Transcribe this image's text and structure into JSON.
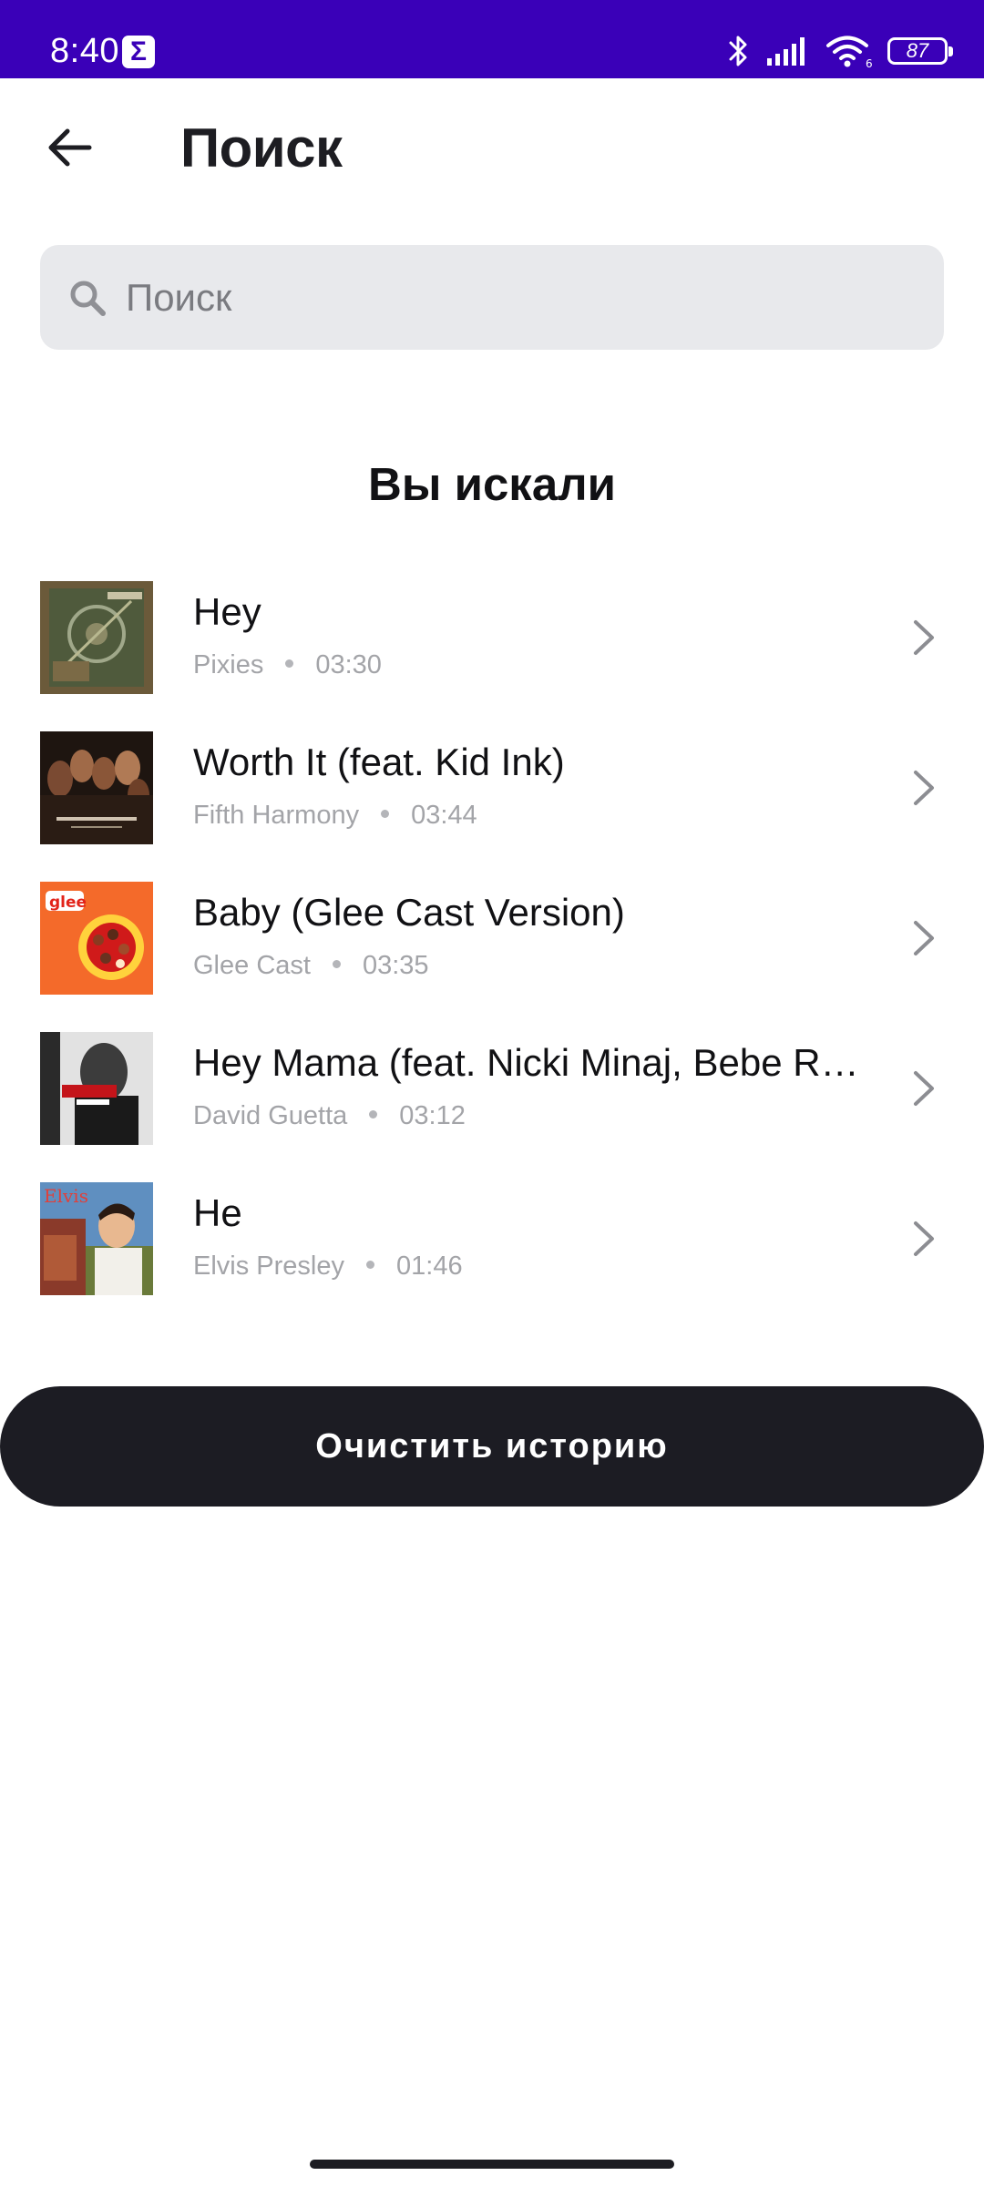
{
  "status_bar": {
    "time": "8:40",
    "notification_icon": "sigma-icon",
    "notification_glyph": "Σ",
    "icons": [
      "bluetooth-icon",
      "signal-icon",
      "wifi-icon",
      "battery-icon"
    ],
    "battery_level": "87",
    "background_color": "#3a00b8"
  },
  "header": {
    "back_icon": "arrow-left-icon",
    "title": "Поиск"
  },
  "search": {
    "icon": "search-icon",
    "placeholder": "Поиск",
    "value": ""
  },
  "history": {
    "title": "Вы искали",
    "items": [
      {
        "title": "Hey",
        "artist": "Pixies",
        "duration": "03:30",
        "cover": "album-cover-pixies"
      },
      {
        "title": "Worth It (feat. Kid Ink)",
        "artist": "Fifth Harmony",
        "duration": "03:44",
        "cover": "album-cover-fifth-harmony"
      },
      {
        "title": "Baby (Glee Cast Version)",
        "artist": "Glee Cast",
        "duration": "03:35",
        "cover": "album-cover-glee"
      },
      {
        "title": "Hey Mama (feat. Nicki Minaj, Bebe Rexha & Afrojack)",
        "artist": "David Guetta",
        "duration": "03:12",
        "cover": "album-cover-david-guetta"
      },
      {
        "title": "He",
        "artist": "Elvis Presley",
        "duration": "01:46",
        "cover": "album-cover-elvis"
      }
    ],
    "row_chevron_icon": "chevron-right-icon"
  },
  "clear_button": {
    "label": "Очистить историю",
    "color": "#1c1c23"
  }
}
